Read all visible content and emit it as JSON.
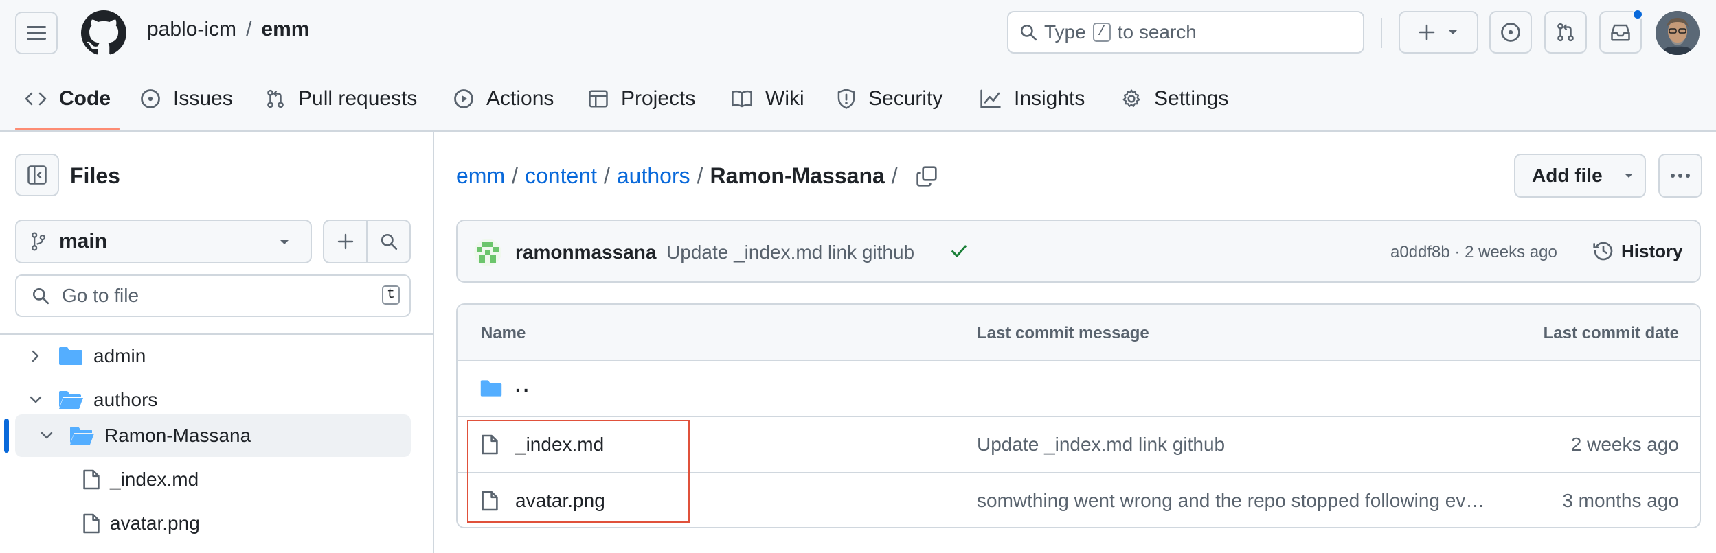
{
  "header": {
    "owner": "pablo-icm",
    "separator": "/",
    "repo": "emm",
    "search_prefix": "Type",
    "search_key": "/",
    "search_suffix": "to search"
  },
  "repo_nav": {
    "tabs": [
      {
        "label": "Code",
        "icon": "code-icon",
        "active": true
      },
      {
        "label": "Issues",
        "icon": "issue-icon"
      },
      {
        "label": "Pull requests",
        "icon": "pull-request-icon"
      },
      {
        "label": "Actions",
        "icon": "play-icon"
      },
      {
        "label": "Projects",
        "icon": "table-icon"
      },
      {
        "label": "Wiki",
        "icon": "book-icon"
      },
      {
        "label": "Security",
        "icon": "shield-icon"
      },
      {
        "label": "Insights",
        "icon": "graph-icon"
      },
      {
        "label": "Settings",
        "icon": "gear-icon"
      }
    ]
  },
  "sidebar": {
    "title": "Files",
    "branch": "main",
    "goto_placeholder": "Go to file",
    "goto_key": "t",
    "tree": [
      {
        "label": "admin",
        "type": "folder",
        "expanded": false
      },
      {
        "label": "authors",
        "type": "folder",
        "expanded": true
      },
      {
        "label": "Ramon-Massana",
        "type": "folder",
        "expanded": true,
        "selected": true
      },
      {
        "label": "_index.md",
        "type": "file"
      },
      {
        "label": "avatar.png",
        "type": "file"
      }
    ]
  },
  "main": {
    "path": [
      "emm",
      "content",
      "authors",
      "Ramon-Massana"
    ],
    "path_sep": "/",
    "add_file": "Add file",
    "latest_commit": {
      "author": "ramonmassana",
      "message": "Update _index.md link github",
      "sha_time": "a0ddf8b · 2 weeks ago",
      "history": "History"
    },
    "table": {
      "headers": [
        "Name",
        "Last commit message",
        "Last commit date"
      ],
      "parent": "..",
      "rows": [
        {
          "name": "_index.md",
          "message": "Update _index.md link github",
          "date": "2 weeks ago"
        },
        {
          "name": "avatar.png",
          "message": "somwthing went wrong and the repo stopped following ev…",
          "date": "3 months ago"
        }
      ]
    }
  },
  "colors": {
    "link": "#0969da",
    "border": "#d0d7de",
    "tab_underline": "#fd8c73",
    "folder": "#54aeff",
    "success": "#1a7f37",
    "annotation": "#e0513b"
  }
}
